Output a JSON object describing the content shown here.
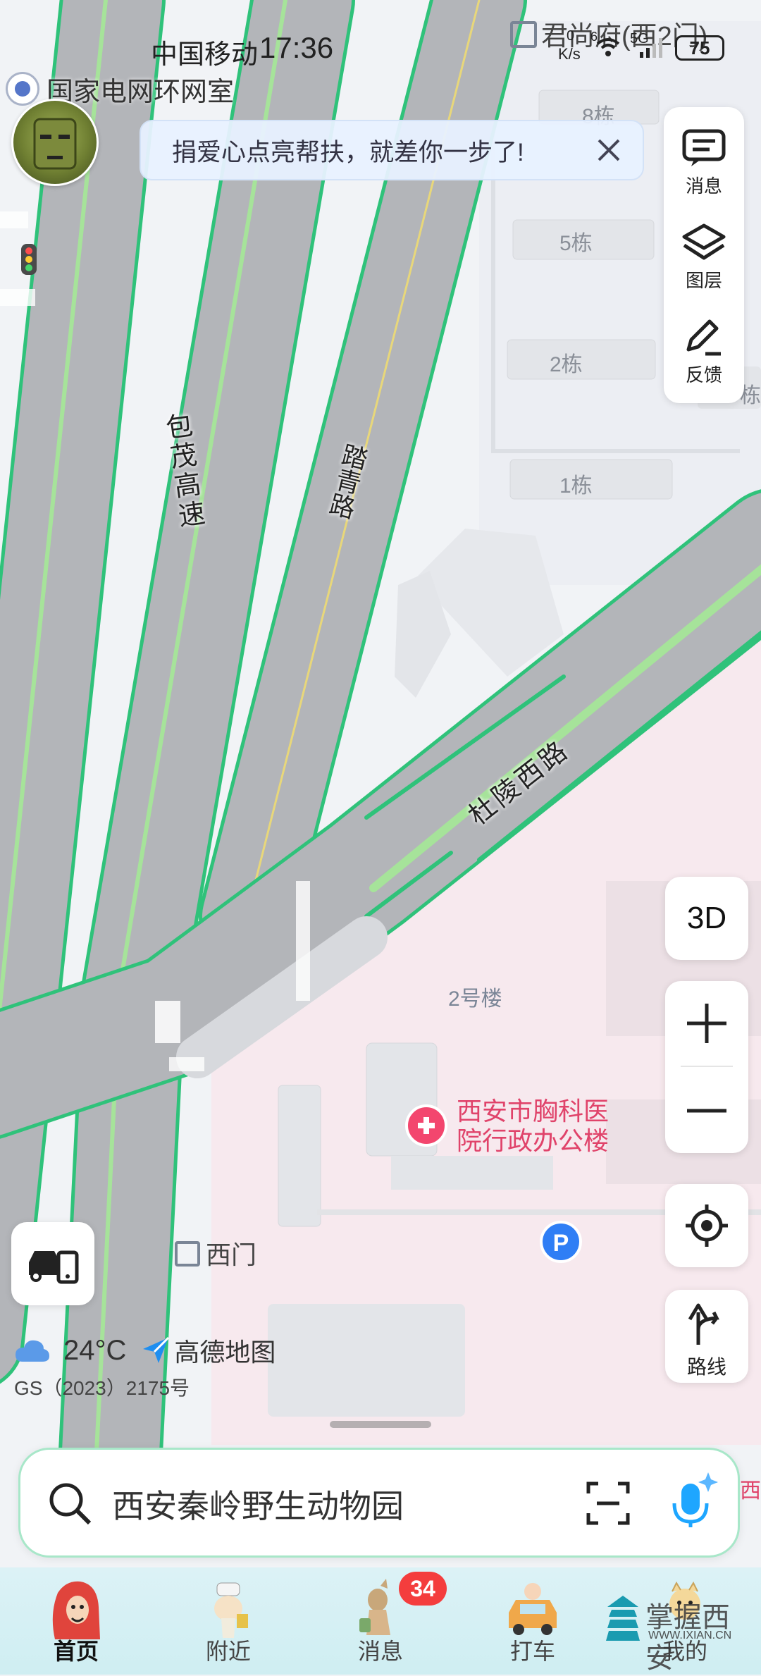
{
  "status_bar": {
    "carrier": "中国移动",
    "time": "17:36",
    "net_speed_top": "0",
    "net_speed_unit": "K/s",
    "signal_6": "6",
    "network": "5G",
    "battery": "75"
  },
  "location_chip": {
    "label": "国家电网环网室"
  },
  "toast": {
    "text": "捐爱心点亮帮扶，就差你一步了!"
  },
  "side_panel": {
    "items": [
      {
        "label": "消息",
        "icon": "message-icon"
      },
      {
        "label": "图层",
        "icon": "layers-icon"
      },
      {
        "label": "反馈",
        "icon": "feedback-pen-icon"
      }
    ]
  },
  "map": {
    "labels": {
      "junshangfu": "君尚府(西2门)",
      "b8": "8栋",
      "b5": "5栋",
      "b2": "2栋",
      "b1": "1栋",
      "dong_edge": "栋",
      "baomao": "包茂高速",
      "taqing": "踏青路",
      "duling": "杜陵西路",
      "lou2": "2号楼",
      "hospital_line1": "西安市胸科医",
      "hospital_line2": "院行政办公楼",
      "ximen": "西门",
      "edge_char": "西"
    },
    "colors": {
      "road": "#b3b5b9",
      "road_edge": "#2fc27a",
      "lane": "#a6e39a",
      "background": "#f1f3f6",
      "hospital_zone": "#f7e9ee"
    }
  },
  "controls": {
    "view_3d": "3D",
    "zoom_in": "+",
    "zoom_out": "−",
    "route_label": "路线"
  },
  "weather": {
    "temp": "24°C",
    "brand": "高德地图"
  },
  "license": "GS（2023）2175号",
  "search": {
    "placeholder": "西安秦岭野生动物园"
  },
  "tabs": [
    {
      "label": "首页",
      "icon": "home-tab-icon",
      "active": true
    },
    {
      "label": "附近",
      "icon": "nearby-tab-icon",
      "active": false
    },
    {
      "label": "消息",
      "icon": "message-tab-icon",
      "active": false
    },
    {
      "label": "打车",
      "icon": "taxi-tab-icon",
      "active": false
    },
    {
      "label": "我的",
      "icon": "profile-tab-icon",
      "active": false
    }
  ],
  "messages_badge": "34",
  "watermark": {
    "text": "掌握西安",
    "url": "WWW.IXIAN.CN"
  }
}
